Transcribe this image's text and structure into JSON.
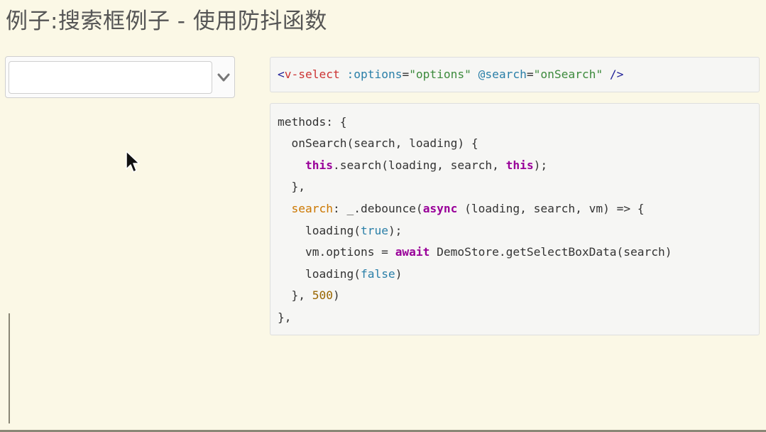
{
  "page": {
    "title": "例子:搜索框例子 - 使用防抖函数"
  },
  "select": {
    "value": "",
    "placeholder": "",
    "toggle_icon": "chevron-down-icon"
  },
  "cursor_icon": "mouse-pointer-icon",
  "template_code": {
    "open": "<",
    "tag": "v-select",
    "attr1": ":options",
    "eq1": "=",
    "val1": "\"options\"",
    "attr2": "@search",
    "eq2": "=",
    "val2": "\"onSearch\"",
    "close": " />"
  },
  "script_code": {
    "l1": "methods: {",
    "l2": "  onSearch(search, loading) {",
    "l3_kw1": "this",
    "l3_mid": ".search(loading, search, ",
    "l3_kw2": "this",
    "l3_end": ");",
    "l4": "  },",
    "l5_prop": "search",
    "l5_mid": ": _.debounce(",
    "l5_kw": "async",
    "l5_end": " (loading, search, vm) => {",
    "l6_a": "loading(",
    "l6_lit": "true",
    "l6_b": ");",
    "l7_a": "vm.options = ",
    "l7_kw": "await",
    "l7_b": " DemoStore.getSelectBoxData(search)",
    "l8_a": "loading(",
    "l8_lit": "false",
    "l8_b": ")",
    "l9_a": "  }, ",
    "l9_num": "500",
    "l9_b": ")",
    "l10": "},"
  },
  "colors": {
    "background": "#fbf8e6",
    "keyword": "#990099",
    "string": "#3c8a3c",
    "attribute": "#2a7fa8",
    "tag_name": "#cc3333",
    "number": "#996600"
  }
}
